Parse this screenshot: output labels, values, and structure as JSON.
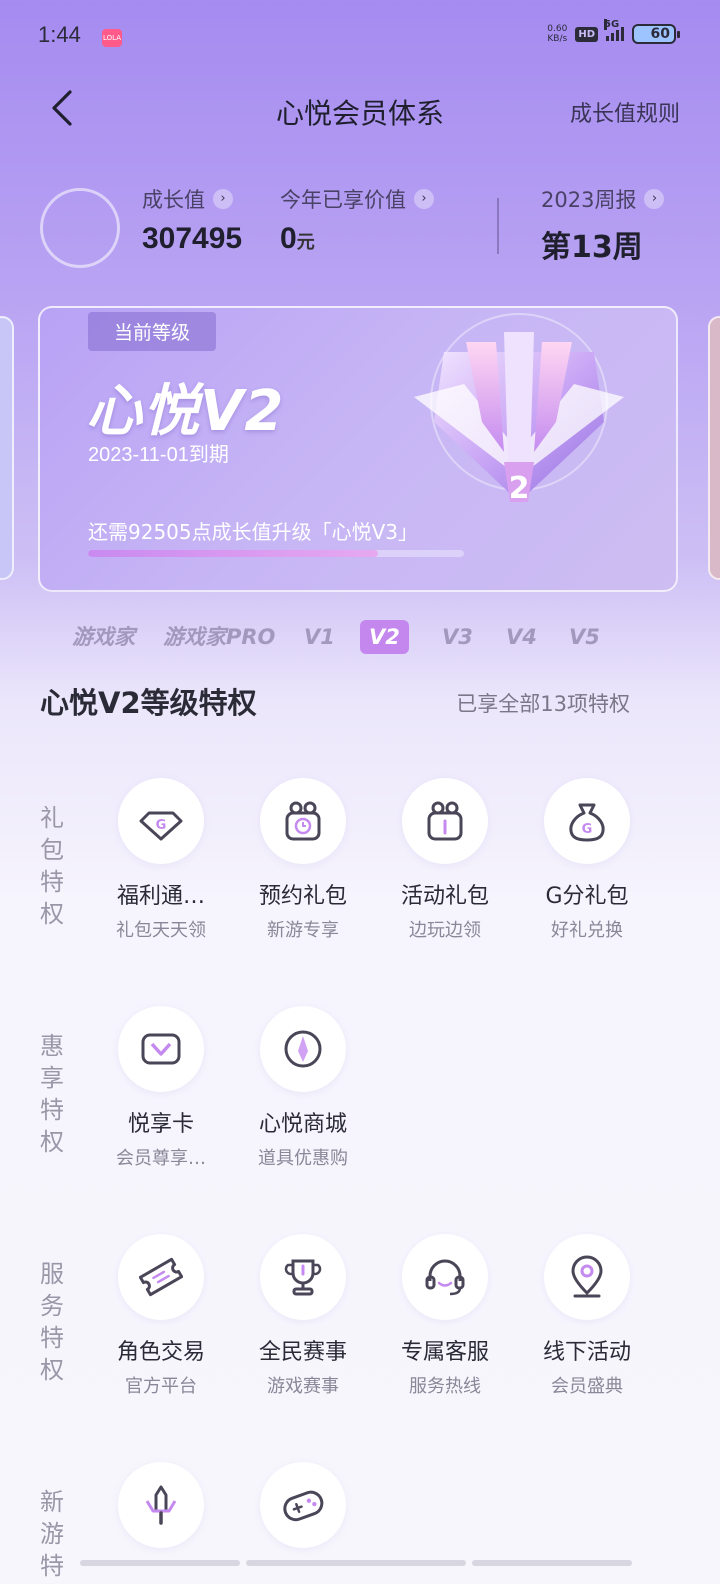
{
  "status_bar": {
    "time": "1:44",
    "app_badge": "LOLA",
    "net_speed": "0.60",
    "net_unit": "KB/s",
    "hd": "HD",
    "signal": "5G",
    "battery": "60"
  },
  "header": {
    "title": "心悦会员体系",
    "rules_link": "成长值规则"
  },
  "stats": {
    "growth_label": "成长值",
    "growth_value": "307495",
    "enjoyed_label": "今年已享价值",
    "enjoyed_value": "0",
    "enjoyed_unit": "元",
    "weekly_label": "2023周报",
    "weekly_value": "第13周"
  },
  "level_card": {
    "tag": "当前等级",
    "level_name": "心悦V2",
    "expiry": "2023-11-01到期",
    "upgrade_text": "还需92505点成长值升级「心悦V3」",
    "progress_fraction": 0.77,
    "badge_number": "2"
  },
  "level_tabs": [
    {
      "label": "游戏家",
      "active": false
    },
    {
      "label": "游戏家PRO",
      "active": false
    },
    {
      "label": "V1",
      "active": false
    },
    {
      "label": "V2",
      "active": true
    },
    {
      "label": "V3",
      "active": false
    },
    {
      "label": "V4",
      "active": false
    },
    {
      "label": "V5",
      "active": false
    }
  ],
  "section": {
    "title": "心悦V2等级特权",
    "subtitle": "已享全部13项特权"
  },
  "groups": [
    {
      "label": [
        "礼",
        "包",
        "特",
        "权"
      ],
      "items": [
        {
          "name": "福利通…",
          "desc": "礼包天天领",
          "icon": "diamond-g-icon"
        },
        {
          "name": "预约礼包",
          "desc": "新游专享",
          "icon": "gift-clock-icon"
        },
        {
          "name": "活动礼包",
          "desc": "边玩边领",
          "icon": "gift-box-icon"
        },
        {
          "name": "G分礼包",
          "desc": "好礼兑换",
          "icon": "money-bag-icon"
        }
      ]
    },
    {
      "label": [
        "惠",
        "享",
        "特",
        "权"
      ],
      "items": [
        {
          "name": "悦享卡",
          "desc": "会员尊享…",
          "icon": "v-card-icon"
        },
        {
          "name": "心悦商城",
          "desc": "道具优惠购",
          "icon": "compass-icon"
        }
      ]
    },
    {
      "label": [
        "服",
        "务",
        "特",
        "权"
      ],
      "items": [
        {
          "name": "角色交易",
          "desc": "官方平台",
          "icon": "ticket-icon"
        },
        {
          "name": "全民赛事",
          "desc": "游戏赛事",
          "icon": "trophy-icon"
        },
        {
          "name": "专属客服",
          "desc": "服务热线",
          "icon": "headset-icon"
        },
        {
          "name": "线下活动",
          "desc": "会员盛典",
          "icon": "location-pin-icon"
        }
      ]
    },
    {
      "label": [
        "新",
        "游",
        "特"
      ],
      "items": [
        {
          "name": "",
          "desc": "",
          "icon": "sword-icon"
        },
        {
          "name": "",
          "desc": "",
          "icon": "gamepad-icon"
        }
      ]
    }
  ],
  "colors": {
    "accent": "#c487ee",
    "header_bg": "#a58bf0",
    "icon_stroke": "#4a4658",
    "icon_accent": "#c58af0"
  }
}
